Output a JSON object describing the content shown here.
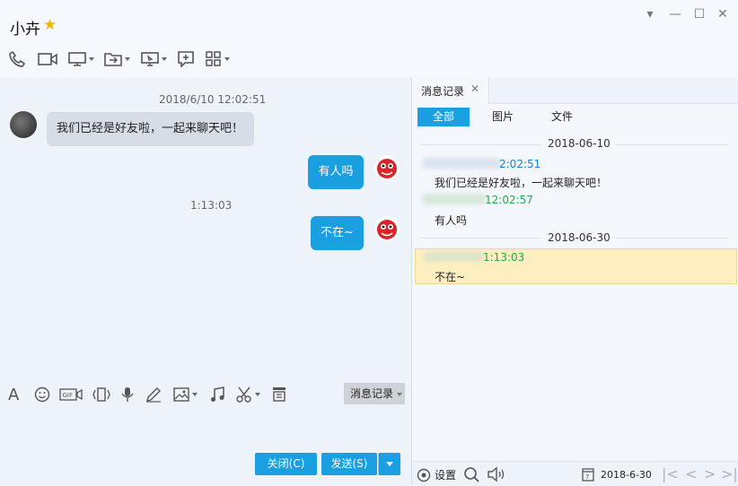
{
  "window": {
    "title": "小卉",
    "controls": [
      "chevron-down-icon",
      "minimize-icon",
      "maximize-icon",
      "close-icon"
    ]
  },
  "toolbar": {
    "icons": [
      "phone-icon",
      "video-icon",
      "screen-share-icon",
      "transfer-file-icon",
      "remote-desktop-icon",
      "add-app-icon",
      "apps-grid-icon"
    ]
  },
  "chat": {
    "messages": [
      {
        "timestamp": "2018/6/10 12:02:51",
        "direction": "in",
        "text": "我们已经是好友啦，一起来聊天吧！"
      },
      {
        "direction": "out",
        "text": "有人吗"
      },
      {
        "timestamp": "1:13:03",
        "direction": "out",
        "text": "不在~"
      }
    ]
  },
  "input_toolbar": {
    "icons": [
      "font-icon",
      "emoji-icon",
      "gif-icon",
      "shake-icon",
      "voice-icon",
      "pen-icon",
      "image-icon",
      "music-icon",
      "scissors-icon",
      "stamp-icon"
    ],
    "history_label": "消息记录"
  },
  "actions": {
    "close_label": "关闭(C)",
    "send_label": "发送(S)"
  },
  "history": {
    "tab_label": "消息记录",
    "filters": [
      "全部",
      "图片",
      "文件"
    ],
    "active_filter": "全部",
    "entries": [
      {
        "date": "2018-06-10"
      },
      {
        "time": "2:02:51",
        "text": "我们已经是好友啦，一起来聊天吧！",
        "time_color": "#1a7fd0"
      },
      {
        "time": "12:02:57",
        "text": "有人吗",
        "time_color": "#2aa64a"
      },
      {
        "date": "2018-06-30"
      },
      {
        "time": "1:13:03",
        "text": "不在~",
        "time_color": "#2aa64a",
        "highlighted": true
      }
    ],
    "settings_label": "设置",
    "date_label": "2018-6-30"
  },
  "colors": {
    "accent": "#1a9fe0",
    "highlight": "#fdefc0"
  }
}
